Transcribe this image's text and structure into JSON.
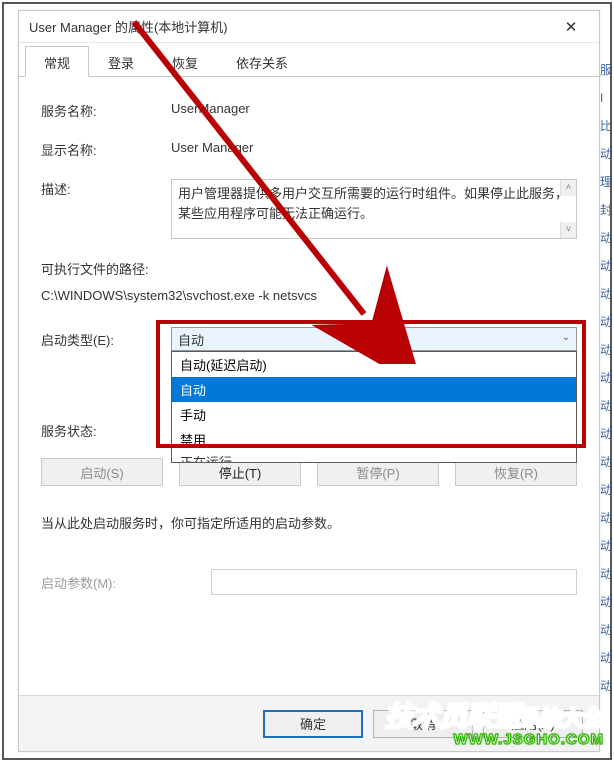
{
  "window": {
    "title": "User Manager 的属性(本地计算机)"
  },
  "tabs": [
    {
      "label": "常规",
      "active": true
    },
    {
      "label": "登录",
      "active": false
    },
    {
      "label": "恢复",
      "active": false
    },
    {
      "label": "依存关系",
      "active": false
    }
  ],
  "fields": {
    "service_name_label": "服务名称:",
    "service_name_value": "UserManager",
    "display_name_label": "显示名称:",
    "display_name_value": "User Manager",
    "description_label": "描述:",
    "description_value": "用户管理器提供多用户交互所需要的运行时组件。如果停止此服务，某些应用程序可能无法正确运行。",
    "exe_path_label": "可执行文件的路径:",
    "exe_path_value": "C:\\WINDOWS\\system32\\svchost.exe -k netsvcs",
    "startup_label": "启动类型(E):",
    "startup_selected": "自动",
    "startup_options": [
      "自动(延迟启动)",
      "自动",
      "手动",
      "禁用"
    ],
    "status_label": "服务状态:",
    "status_value": "正在运行",
    "note": "当从此处启动服务时，你可指定所适用的启动参数。",
    "param_label": "启动参数(M):"
  },
  "controls": {
    "start": "启动(S)",
    "stop": "停止(T)",
    "pause": "暂停(P)",
    "resume": "恢复(R)"
  },
  "footer": {
    "ok": "确定",
    "cancel": "取消",
    "apply": "应用(A)"
  },
  "watermark": {
    "line1a": "技术员联盟",
    "line1b": "系统大全",
    "line2": "WWW.JSGHO.COM"
  }
}
